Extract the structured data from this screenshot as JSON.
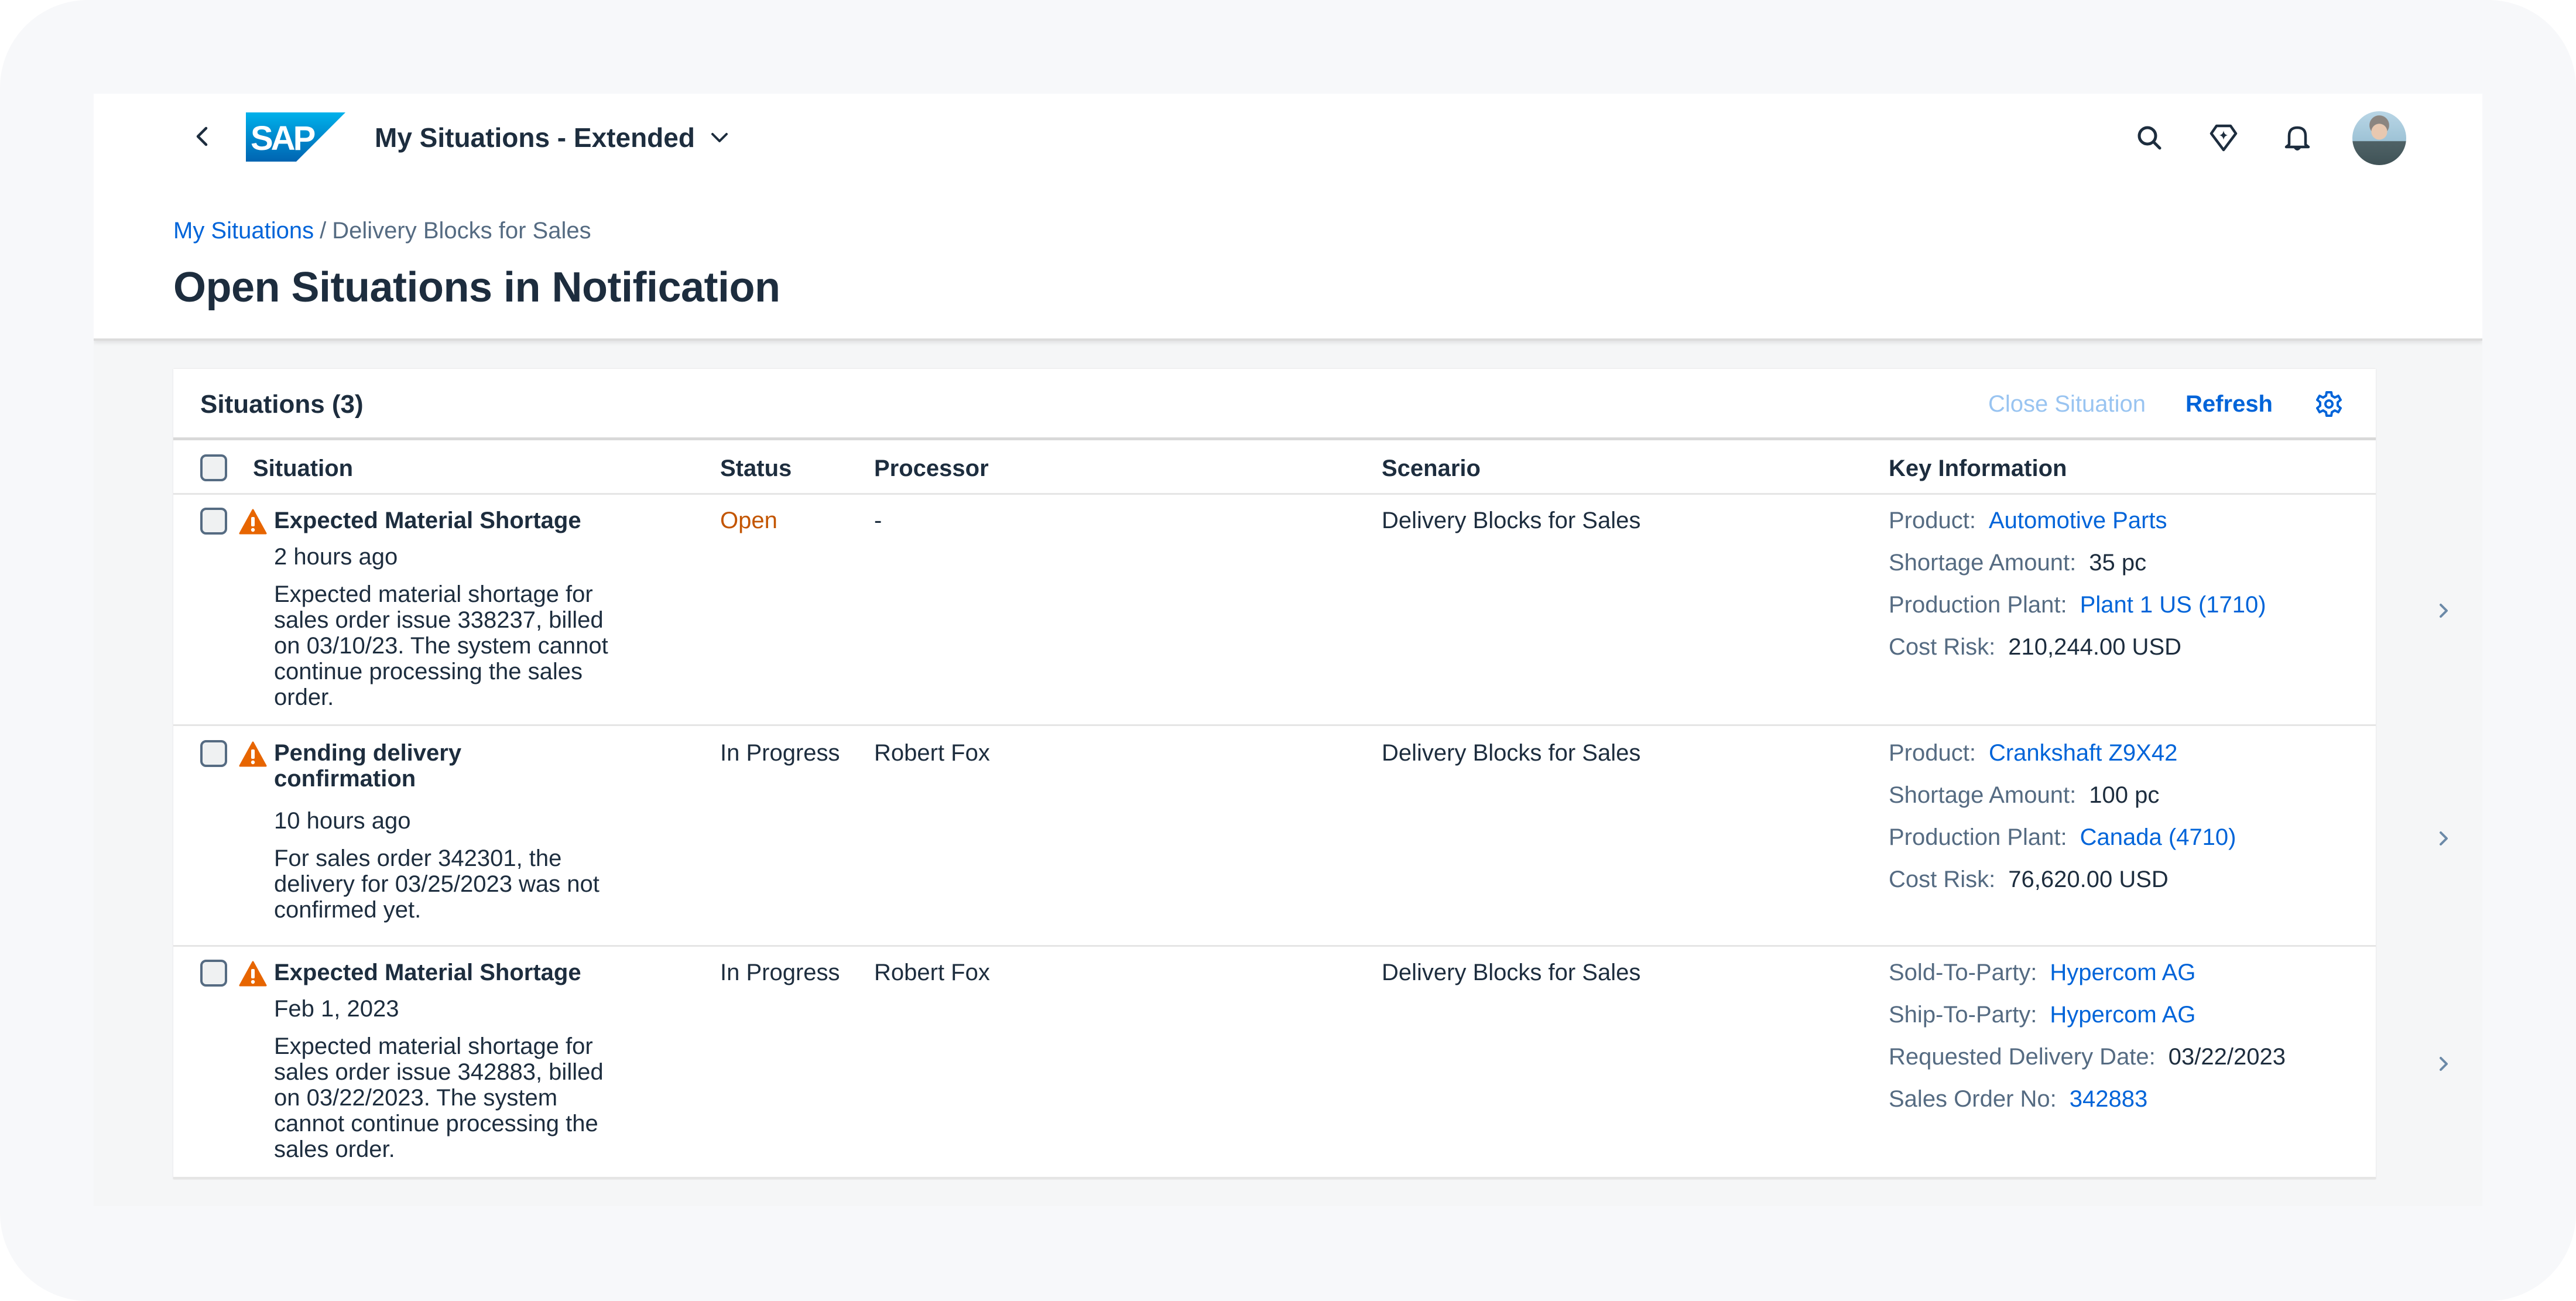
{
  "shell": {
    "app_title": "My Situations - Extended",
    "logo_text": "SAP",
    "icons": [
      "back-icon",
      "search-icon",
      "joule-diamond-icon",
      "bell-icon"
    ]
  },
  "breadcrumb": {
    "link": "My Situations",
    "separator": "/",
    "current": "Delivery Blocks for Sales"
  },
  "page_title": "Open Situations in Notification",
  "table": {
    "title": "Situations (3)",
    "actions": {
      "close_situation": "Close Situation",
      "refresh": "Refresh"
    },
    "columns": [
      "Situation",
      "Status",
      "Processor",
      "Scenario",
      "Key Information"
    ],
    "rows": [
      {
        "title": "Expected Material Shortage",
        "time": "2 hours ago",
        "description": "Expected material shortage for sales order issue 338237, billed on 03/10/23. The system cannot continue processing the sales order.",
        "status": "Open",
        "processor": "-",
        "scenario": "Delivery Blocks for Sales",
        "key_info": [
          {
            "label": "Product:",
            "value": "Automotive Parts",
            "link": true
          },
          {
            "label": "Shortage Amount:",
            "value": "35 pc",
            "link": false
          },
          {
            "label": "Production Plant:",
            "value": "Plant 1 US (1710)",
            "link": true
          },
          {
            "label": "Cost Risk:",
            "value": "210,244.00 USD",
            "link": false
          }
        ]
      },
      {
        "title": "Pending delivery confirmation",
        "time": "10 hours ago",
        "description": "For sales order 342301, the delivery for 03/25/2023 was not confirmed yet.",
        "status": "In Progress",
        "processor": "Robert Fox",
        "scenario": "Delivery Blocks for Sales",
        "key_info": [
          {
            "label": "Product:",
            "value": "Crankshaft Z9X42",
            "link": true
          },
          {
            "label": "Shortage Amount:",
            "value": "100 pc",
            "link": false
          },
          {
            "label": "Production Plant:",
            "value": "Canada (4710)",
            "link": true
          },
          {
            "label": "Cost Risk:",
            "value": "76,620.00 USD",
            "link": false
          }
        ]
      },
      {
        "title": "Expected Material Shortage",
        "time": "Feb 1, 2023",
        "description": "Expected material shortage for sales order issue 342883, billed on 03/22/2023. The system cannot continue processing the sales order.",
        "status": "In Progress",
        "processor": "Robert Fox",
        "scenario": "Delivery Blocks for Sales",
        "key_info": [
          {
            "label": "Sold-To-Party:",
            "value": "Hypercom AG",
            "link": true
          },
          {
            "label": "Ship-To-Party:",
            "value": "Hypercom AG",
            "link": true
          },
          {
            "label": "Requested Delivery Date:",
            "value": "03/22/2023",
            "link": false
          },
          {
            "label": "Sales Order No:",
            "value": "342883",
            "link": true
          }
        ]
      }
    ]
  },
  "colors": {
    "link": "#0064d9",
    "text": "#1d2d3e",
    "label": "#556b82",
    "status_open": "#c35500",
    "warning_icon": "#e76500",
    "disabled_action": "#99c4f1"
  }
}
